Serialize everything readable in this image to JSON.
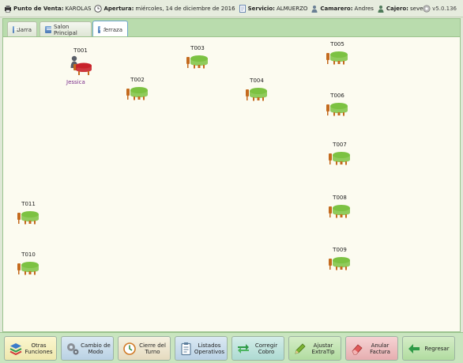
{
  "header": {
    "pos_label": "Punto de Venta:",
    "pos_value": "KAROLAS",
    "opening_label": "Apertura:",
    "opening_value": "miércoles, 14 de diciembre de 2016",
    "service_label": "Servicio:",
    "service_value": "ALMUERZO",
    "waiter_label": "Camarero:",
    "waiter_value": "Andres",
    "cashier_label": "Cajero:",
    "cashier_value": "seven",
    "version": "v5.0.136"
  },
  "tabs": [
    {
      "label": "Barra",
      "active": false
    },
    {
      "label": "Salon Principal",
      "active": false
    },
    {
      "label": "Terraza",
      "active": true
    }
  ],
  "tables": [
    {
      "id": "T001",
      "status": "occupied",
      "waiter": "Jessica"
    },
    {
      "id": "T002",
      "status": "free"
    },
    {
      "id": "T003",
      "status": "free"
    },
    {
      "id": "T004",
      "status": "free"
    },
    {
      "id": "T005",
      "status": "free"
    },
    {
      "id": "T006",
      "status": "free"
    },
    {
      "id": "T007",
      "status": "free"
    },
    {
      "id": "T008",
      "status": "free"
    },
    {
      "id": "T009",
      "status": "free"
    },
    {
      "id": "T010",
      "status": "free"
    },
    {
      "id": "T011",
      "status": "free"
    }
  ],
  "buttons": [
    {
      "line1": "Otras",
      "line2": "Funciones",
      "icon": "layers-icon"
    },
    {
      "line1": "Cambio de",
      "line2": "Modo",
      "icon": "gears-icon"
    },
    {
      "line1": "Cierre del",
      "line2": "Turno",
      "icon": "clock-icon"
    },
    {
      "line1": "Listados",
      "line2": "Operativos",
      "icon": "clipboard-icon"
    },
    {
      "line1": "Corregir",
      "line2": "Cobro",
      "icon": "swap-arrows-icon"
    },
    {
      "line1": "Ajustar",
      "line2": "ExtraTip",
      "icon": "pencil-icon"
    },
    {
      "line1": "Anular",
      "line2": "Factura",
      "icon": "eraser-icon"
    },
    {
      "line1": "Regresar",
      "line2": "",
      "icon": "back-arrow-icon"
    }
  ],
  "colors": {
    "table_free": "#7cc242",
    "table_occupied": "#c8222a",
    "chair": "#c46a1e",
    "waiter_name": "#7a2c8c"
  }
}
